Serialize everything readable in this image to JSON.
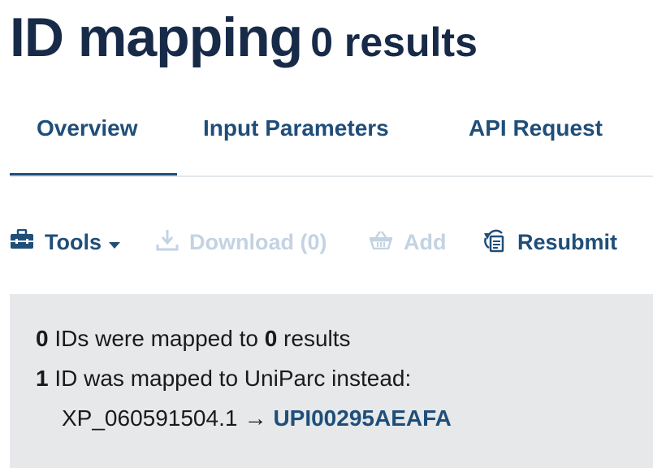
{
  "header": {
    "title": "ID mapping",
    "result_count": "0 results"
  },
  "tabs": [
    {
      "label": "Overview",
      "active": true
    },
    {
      "label": "Input Parameters",
      "active": false
    },
    {
      "label": "API Request",
      "active": false
    }
  ],
  "toolbar": {
    "tools_label": "Tools",
    "download_label": "Download (0)",
    "add_label": "Add",
    "resubmit_label": "Resubmit"
  },
  "summary": {
    "mapped_count": "0",
    "mapped_text_1": " IDs were mapped to ",
    "results_count": "0",
    "mapped_text_2": " results",
    "uniparc_count": "1",
    "uniparc_text": " ID was mapped to UniParc instead:",
    "source_id": "XP_060591504.1",
    "arrow": "→",
    "uniparc_id": "UPI00295AEAFA"
  },
  "colors": {
    "title": "#172a48",
    "accent": "#1f4e79",
    "disabled": "#c3d3e3",
    "info_bg": "#e6e8ea",
    "tab_border": "#e2e6ea"
  },
  "icons": {
    "tools": "toolbox-icon",
    "tools_caret": "caret-down-icon",
    "download": "download-icon",
    "add": "basket-icon",
    "resubmit": "resubmit-icon"
  }
}
